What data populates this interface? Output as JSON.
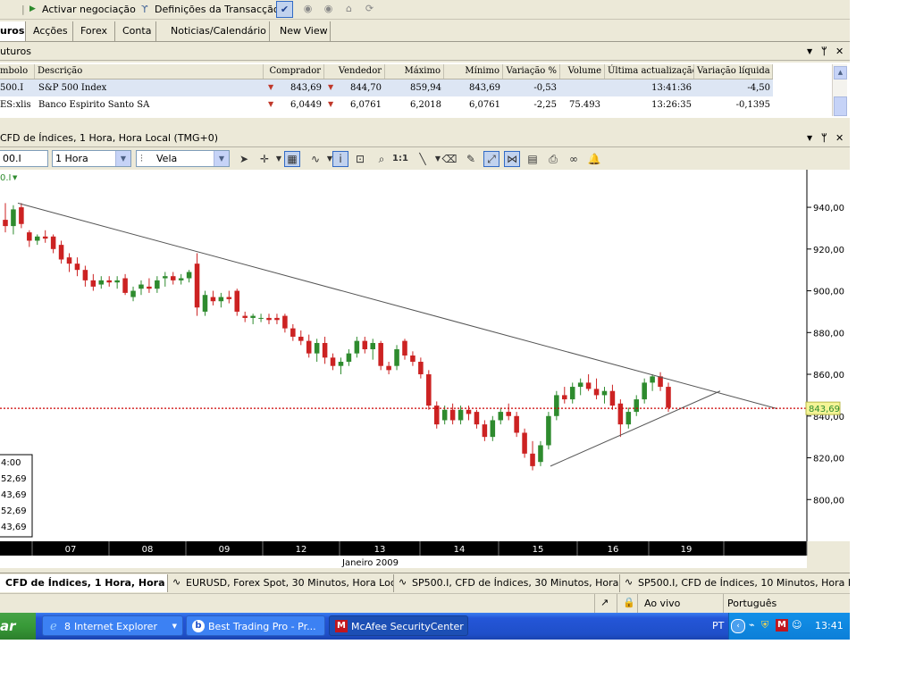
{
  "toolbar": {
    "activate_label": "Activar negociação",
    "settings_label": "Definições da Transacção"
  },
  "tabs": [
    {
      "label": "uros"
    },
    {
      "label": "Acções"
    },
    {
      "label": "Forex"
    },
    {
      "label": "Conta"
    },
    {
      "label": "Noticias/Calendário"
    },
    {
      "label": "New View"
    }
  ],
  "watchlist": {
    "title": "uturos",
    "columns": [
      "mbolo",
      "Descrição",
      "Comprador",
      "Vendedor",
      "Máximo",
      "Mínimo",
      "Variação %",
      "Volume",
      "Última actualização",
      "Variação líquida"
    ],
    "rows": [
      {
        "symbol": "500.I",
        "description": "S&P 500 Index",
        "bid": "843,69",
        "ask": "844,70",
        "high": "859,94",
        "low": "843,69",
        "change_pct": "-0,53",
        "volume": "",
        "updated": "13:41:36",
        "net_change": "-4,50"
      },
      {
        "symbol": "ES:xlis",
        "description": "Banco Espirito Santo SA",
        "bid": "6,0449",
        "ask": "6,0761",
        "high": "6,2018",
        "low": "6,0761",
        "change_pct": "-2,25",
        "volume": "75.493",
        "updated": "13:26:35",
        "net_change": "-0,1395"
      }
    ]
  },
  "chart_panel": {
    "title": "CFD de Índices, 1 Hora, Hora Local (TMG+0)",
    "symbol_value": "00.I",
    "interval_value": "1 Hora",
    "type_value": "Vela",
    "instrument_tag": "0.I",
    "info_box": [
      "4:00",
      "52,69",
      "43,69",
      "52,69",
      "43,69"
    ],
    "price_tag": "843,69",
    "colors": {
      "up": "#2e8b2e",
      "down": "#cc2222",
      "price_line": "#cc0000",
      "trend": "#555555"
    }
  },
  "chart_data": {
    "type": "candlestick",
    "y_ticks": [
      "940,00",
      "920,00",
      "900,00",
      "880,00",
      "860,00",
      "840,00",
      "820,00",
      "800,00"
    ],
    "y_values": [
      940,
      920,
      900,
      880,
      860,
      840,
      820,
      800
    ],
    "ylim": [
      780,
      958
    ],
    "x_ticks": [
      "07",
      "08",
      "09",
      "12",
      "13",
      "14",
      "15",
      "16",
      "19"
    ],
    "x_month": "Janeiro 2009",
    "last_price": 843.69,
    "candles": [
      [
        934,
        942,
        928,
        931
      ],
      [
        931,
        941,
        927,
        939
      ],
      [
        940,
        942,
        930,
        932
      ],
      [
        928,
        929,
        921,
        924
      ],
      [
        924,
        927,
        922,
        926
      ],
      [
        926,
        929,
        923,
        925
      ],
      [
        926,
        927,
        918,
        920
      ],
      [
        922,
        924,
        913,
        915
      ],
      [
        916,
        918,
        909,
        913
      ],
      [
        913,
        916,
        907,
        910
      ],
      [
        910,
        912,
        902,
        905
      ],
      [
        905,
        908,
        900,
        902
      ],
      [
        903,
        907,
        901,
        905
      ],
      [
        905,
        907,
        902,
        904
      ],
      [
        904,
        907,
        901,
        905
      ],
      [
        906,
        908,
        898,
        899
      ],
      [
        897,
        902,
        895,
        900
      ],
      [
        901,
        905,
        898,
        903
      ],
      [
        902,
        906,
        899,
        901
      ],
      [
        901,
        907,
        899,
        905
      ],
      [
        906,
        909,
        902,
        907
      ],
      [
        907,
        909,
        903,
        905
      ],
      [
        905,
        908,
        903,
        906
      ],
      [
        906,
        910,
        904,
        909
      ],
      [
        913,
        918,
        888,
        892
      ],
      [
        890,
        900,
        888,
        898
      ],
      [
        897,
        900,
        893,
        895
      ],
      [
        895,
        899,
        892,
        897
      ],
      [
        897,
        900,
        894,
        896
      ],
      [
        900,
        901,
        888,
        890
      ],
      [
        888,
        890,
        885,
        887
      ],
      [
        887,
        889,
        884,
        888
      ],
      [
        887,
        889,
        885,
        887
      ],
      [
        887,
        889,
        884,
        886
      ],
      [
        887,
        889,
        884,
        886
      ],
      [
        888,
        889,
        880,
        882
      ],
      [
        882,
        884,
        876,
        878
      ],
      [
        878,
        881,
        874,
        876
      ],
      [
        876,
        879,
        868,
        870
      ],
      [
        870,
        877,
        866,
        875
      ],
      [
        875,
        878,
        865,
        868
      ],
      [
        868,
        870,
        862,
        864
      ],
      [
        864,
        868,
        860,
        866
      ],
      [
        866,
        872,
        864,
        870
      ],
      [
        870,
        878,
        868,
        876
      ],
      [
        876,
        878,
        870,
        872
      ],
      [
        872,
        877,
        867,
        875
      ],
      [
        875,
        876,
        862,
        864
      ],
      [
        864,
        866,
        860,
        862
      ],
      [
        864,
        874,
        862,
        872
      ],
      [
        876,
        877,
        867,
        869
      ],
      [
        869,
        871,
        864,
        866
      ],
      [
        866,
        868,
        858,
        860
      ],
      [
        860,
        862,
        843,
        845
      ],
      [
        845,
        847,
        834,
        836
      ],
      [
        838,
        845,
        836,
        843
      ],
      [
        843,
        846,
        836,
        838
      ],
      [
        838,
        845,
        836,
        843
      ],
      [
        843,
        845,
        838,
        841
      ],
      [
        842,
        843,
        834,
        836
      ],
      [
        836,
        838,
        828,
        830
      ],
      [
        830,
        840,
        828,
        838
      ],
      [
        838,
        844,
        836,
        842
      ],
      [
        842,
        846,
        838,
        840
      ],
      [
        840,
        842,
        830,
        832
      ],
      [
        832,
        834,
        820,
        822
      ],
      [
        822,
        828,
        814,
        816
      ],
      [
        818,
        828,
        816,
        826
      ],
      [
        826,
        842,
        824,
        840
      ],
      [
        840,
        852,
        838,
        850
      ],
      [
        850,
        854,
        846,
        848
      ],
      [
        848,
        856,
        846,
        854
      ],
      [
        854,
        858,
        850,
        856
      ],
      [
        856,
        860,
        852,
        853
      ],
      [
        853,
        858,
        848,
        850
      ],
      [
        850,
        854,
        846,
        852
      ],
      [
        852,
        855,
        843,
        845
      ],
      [
        846,
        848,
        830,
        836
      ],
      [
        836,
        844,
        834,
        842
      ],
      [
        842,
        850,
        840,
        848
      ],
      [
        848,
        858,
        846,
        856
      ],
      [
        856,
        860,
        852,
        859
      ],
      [
        859,
        861,
        852,
        854
      ],
      [
        854,
        856,
        842,
        844
      ]
    ]
  },
  "doc_tabs": [
    {
      "label": "CFD de Índices, 1 Hora, Hora L..."
    },
    {
      "label": "EURUSD, Forex Spot, 30 Minutos, Hora Local..."
    },
    {
      "label": "SP500.I, CFD de Índices, 30 Minutos, Hora L..."
    },
    {
      "label": "SP500.I, CFD de Índices, 10 Minutos, Hora L..."
    }
  ],
  "status": {
    "live_label": "Ao vivo",
    "language": "Português"
  },
  "taskbar": {
    "start_label": "ar",
    "ie_count": "8",
    "ie_label": "Internet Explorer",
    "task_best": "Best Trading Pro - Pr...",
    "task_mcafee": "McAfee SecurityCenter",
    "lang": "PT",
    "clock": "13:41"
  }
}
